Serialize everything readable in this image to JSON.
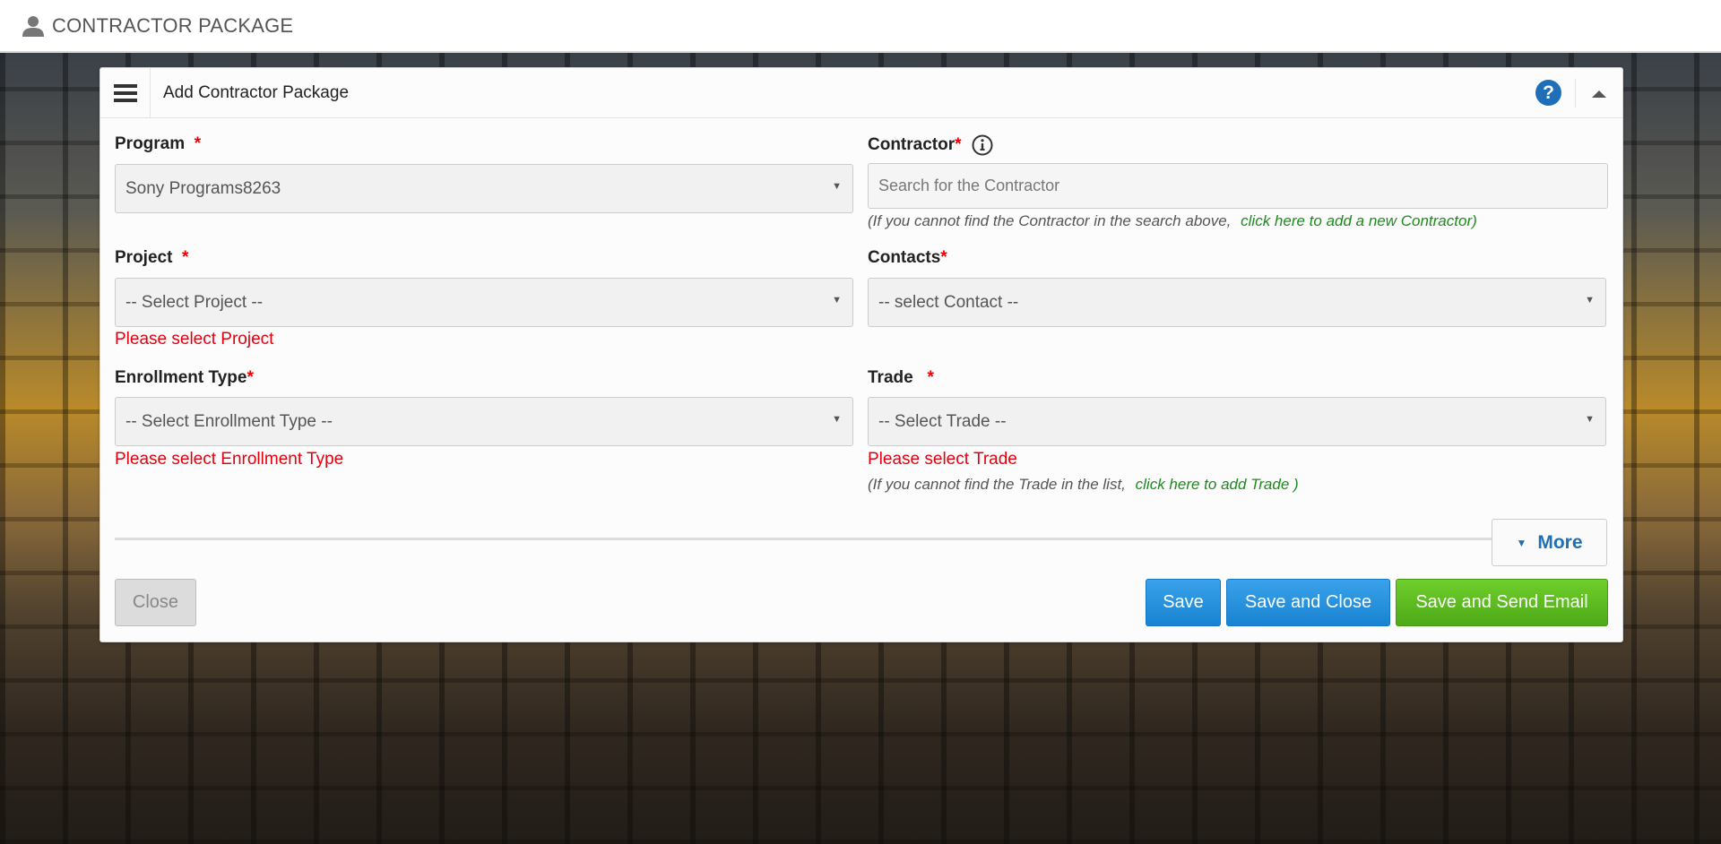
{
  "topbar": {
    "title": "CONTRACTOR PACKAGE",
    "icon": "user-icon"
  },
  "panel": {
    "title": "Add Contractor Package",
    "help_label": "?"
  },
  "program": {
    "label": "Program",
    "required": "*",
    "value": "Sony Programs8263"
  },
  "contractor": {
    "label": "Contractor",
    "required": "*",
    "placeholder": "Search for the Contractor",
    "hint": "(If you cannot find the Contractor in the search above,",
    "hint_link": "click here to add a new Contractor)"
  },
  "project": {
    "label": "Project",
    "required": "*",
    "value": "-- Select Project --",
    "error": "Please select Project"
  },
  "contacts": {
    "label": "Contacts",
    "required": "*",
    "value": "-- select Contact --"
  },
  "enrollment": {
    "label": "Enrollment Type",
    "required": "*",
    "value": "-- Select Enrollment Type --",
    "error": "Please select Enrollment Type"
  },
  "trade": {
    "label": "Trade",
    "required": "*",
    "value": "-- Select Trade --",
    "error": "Please select Trade",
    "hint": "(If you cannot find the Trade in the list,",
    "hint_link": "click here to add Trade )"
  },
  "more": {
    "label": "More"
  },
  "buttons": {
    "close": "Close",
    "save": "Save",
    "save_close": "Save and Close",
    "save_email": "Save and Send Email"
  },
  "colors": {
    "accent": "#1e6fb8",
    "error": "#e3000f",
    "link": "#1c8a1c",
    "primary": "#1883d2",
    "success": "#4ea917"
  }
}
